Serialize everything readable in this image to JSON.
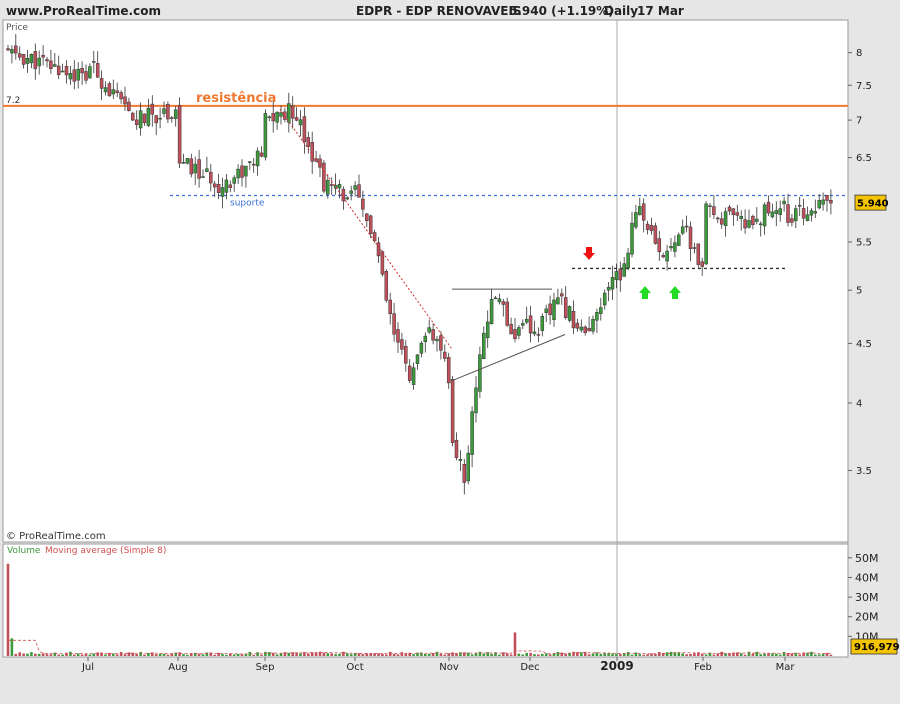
{
  "header": {
    "site": "www.ProRealTime.com",
    "symbol": "EDPR - EDP RENOVAVEIS",
    "quote": "5.940 (+1.19%)",
    "period": "Daily",
    "date": "17 Mar"
  },
  "price_panel": {
    "title": "Price",
    "copyright": "© ProRealTime.com"
  },
  "volume_panel": {
    "title_volume": "Volume",
    "title_ma": "Moving average (Simple 8)"
  },
  "colors": {
    "up": "#3c9a3c",
    "down": "#c0505a",
    "resistance": "#f07830",
    "support": "#3a6fd8",
    "last_price_tag": "#f5c400"
  },
  "chart_data": {
    "type": "candlestick",
    "x_ticks": [
      "Jul",
      "Aug",
      "Sep",
      "Oct",
      "Nov",
      "Dec",
      "2009",
      "Feb",
      "Mar"
    ],
    "price_axis": {
      "scale": "log",
      "ticks": [
        "8",
        "7.5",
        "7",
        "6.5",
        "5.5",
        "5",
        "4.5",
        "4",
        "3.5"
      ],
      "range": [
        3.05,
        8.5
      ]
    },
    "last_price": "5.940",
    "resistance": {
      "label": "resistência",
      "value": 7.2,
      "axis_label": "7.2"
    },
    "support": {
      "label": "suporte",
      "value": 6.03
    },
    "path_waypoints": [
      [
        "Jun",
        8.0
      ],
      [
        "Jun",
        7.6
      ],
      [
        "Jul",
        7.85
      ],
      [
        "Jul",
        7.0
      ],
      [
        "Jul",
        7.15
      ],
      [
        "Aug",
        6.45
      ],
      [
        "Aug",
        6.15
      ],
      [
        "Aug",
        6.55
      ],
      [
        "Sep",
        7.0
      ],
      [
        "Sep",
        7.15
      ],
      [
        "Sep",
        6.15
      ],
      [
        "Sep",
        6.0
      ],
      [
        "Oct",
        6.05
      ],
      [
        "Oct",
        5.55
      ],
      [
        "Oct",
        4.6
      ],
      [
        "Oct",
        4.2
      ],
      [
        "Oct",
        4.65
      ],
      [
        "Oct",
        4.2
      ],
      [
        "Nov",
        3.75
      ],
      [
        "Nov",
        3.45
      ],
      [
        "Nov",
        4.55
      ],
      [
        "Nov",
        5.0
      ],
      [
        "Nov",
        4.55
      ],
      [
        "Nov",
        4.85
      ],
      [
        "Dec",
        4.55
      ],
      [
        "Dec",
        4.9
      ],
      [
        "Dec",
        4.55
      ],
      [
        "Dec",
        5.2
      ],
      [
        "Jan",
        5.0
      ],
      [
        "Jan",
        5.95
      ],
      [
        "Jan",
        5.3
      ],
      [
        "Jan",
        5.7
      ],
      [
        "Jan",
        5.2
      ],
      [
        "Feb",
        5.85
      ],
      [
        "Feb",
        5.7
      ],
      [
        "Feb",
        5.95
      ],
      [
        "Mar",
        5.75
      ],
      [
        "Mar",
        5.85
      ],
      [
        "Mar",
        5.94
      ]
    ],
    "volume": {
      "axis_ticks": [
        "50M",
        "40M",
        "30M",
        "20M",
        "10M"
      ],
      "range": [
        0,
        55
      ],
      "last_value": "916,979",
      "spikes": [
        [
          "start",
          47
        ],
        [
          "start",
          9
        ],
        [
          "Nov",
          12
        ]
      ]
    }
  }
}
